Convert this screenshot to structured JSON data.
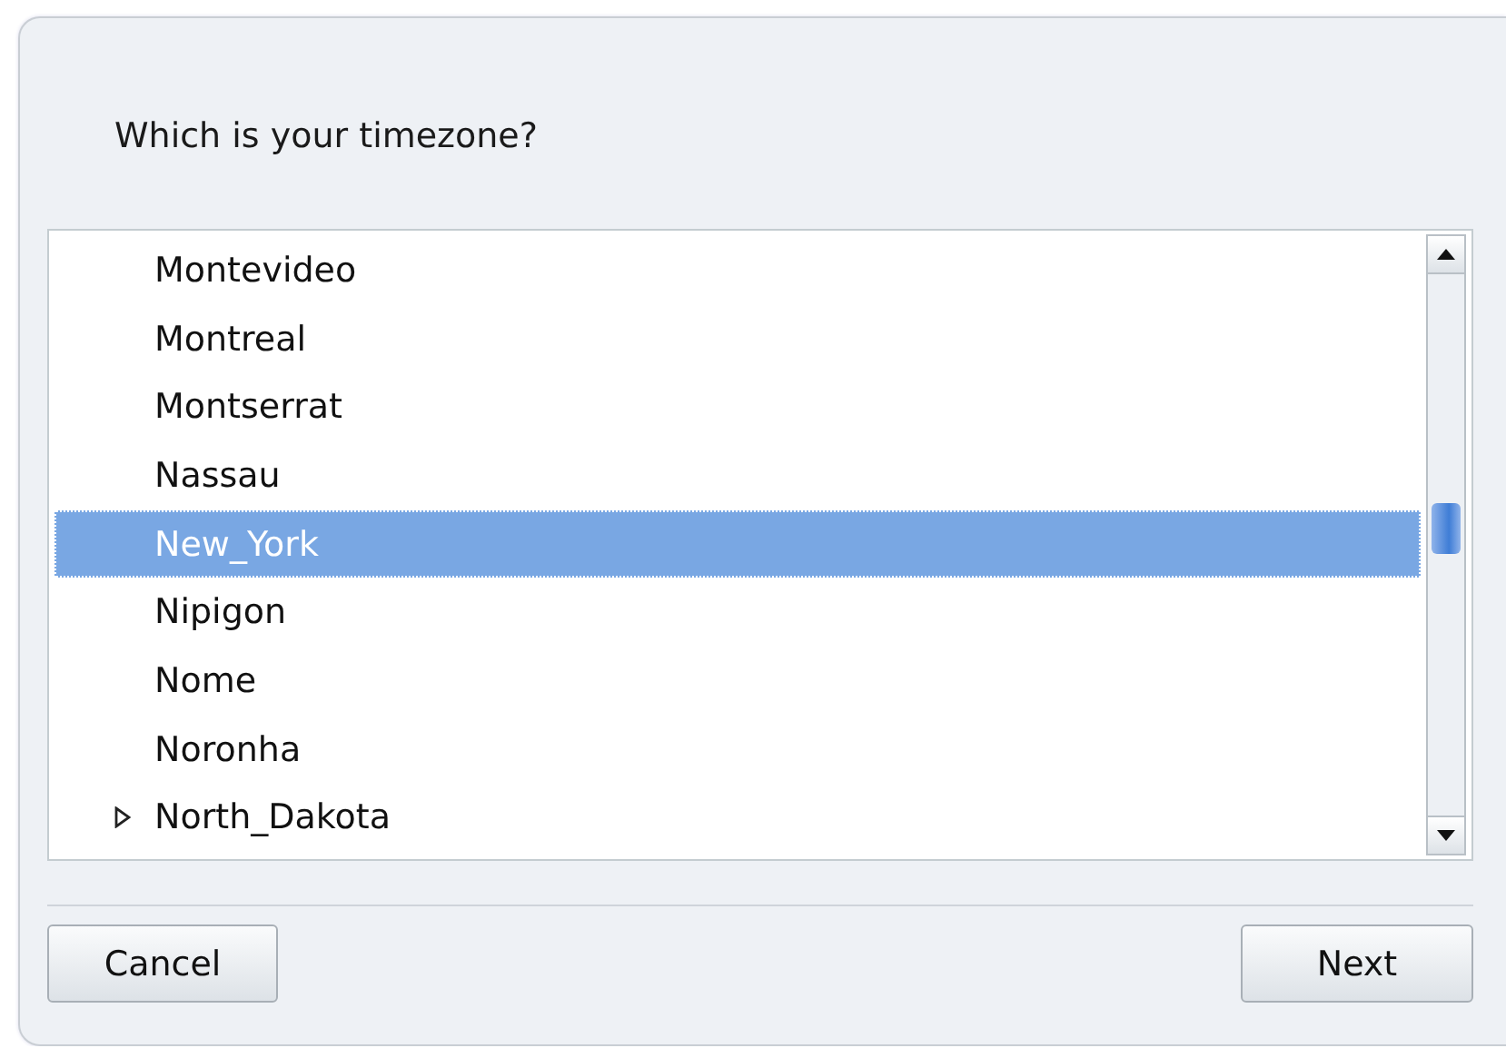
{
  "question": "Which is your timezone?",
  "timezones": [
    {
      "name": "Montevideo",
      "kind": "leaf",
      "selected": false
    },
    {
      "name": "Montreal",
      "kind": "leaf",
      "selected": false
    },
    {
      "name": "Montserrat",
      "kind": "leaf",
      "selected": false
    },
    {
      "name": "Nassau",
      "kind": "leaf",
      "selected": false
    },
    {
      "name": "New_York",
      "kind": "leaf",
      "selected": true
    },
    {
      "name": "Nipigon",
      "kind": "leaf",
      "selected": false
    },
    {
      "name": "Nome",
      "kind": "leaf",
      "selected": false
    },
    {
      "name": "Noronha",
      "kind": "leaf",
      "selected": false
    },
    {
      "name": "North_Dakota",
      "kind": "group",
      "expanded": false,
      "selected": false
    }
  ],
  "buttons": [
    {
      "label": "Cancel",
      "kind": "cancel"
    },
    {
      "label": "Next",
      "kind": "next"
    }
  ]
}
